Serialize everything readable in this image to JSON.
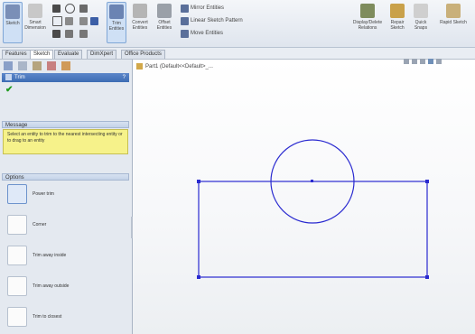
{
  "ribbon": {
    "sketch": "Sketch",
    "smart_dimension": "Smart Dimension",
    "trim": "Trim Entities",
    "convert": "Convert Entities",
    "offset": "Offset Entities",
    "mirror": "Mirror Entities",
    "linear_pattern": "Linear Sketch Pattern",
    "move": "Move Entities",
    "display_relations": "Display/Delete Relations",
    "repair": "Repair Sketch",
    "quick_snaps": "Quick Snaps",
    "rapid_sketch": "Rapid Sketch"
  },
  "tabs": [
    "Features",
    "Sketch",
    "Evaluate",
    "DimXpert",
    "Office Products"
  ],
  "panel": {
    "title": "Trim",
    "message_header": "Message",
    "message_text": "Select an entity to trim to the nearest intersecting entity or to drag to an entity",
    "options_header": "Options",
    "options": [
      "Power trim",
      "Corner",
      "Trim away inside",
      "Trim away outside",
      "Trim to closest"
    ]
  },
  "tree": {
    "label": "Part1 (Default<<Default>_..."
  },
  "colors": {
    "sketch": "#2a2ad0",
    "message_bg": "#f6f28a",
    "panel_header": "#3d6db4"
  }
}
